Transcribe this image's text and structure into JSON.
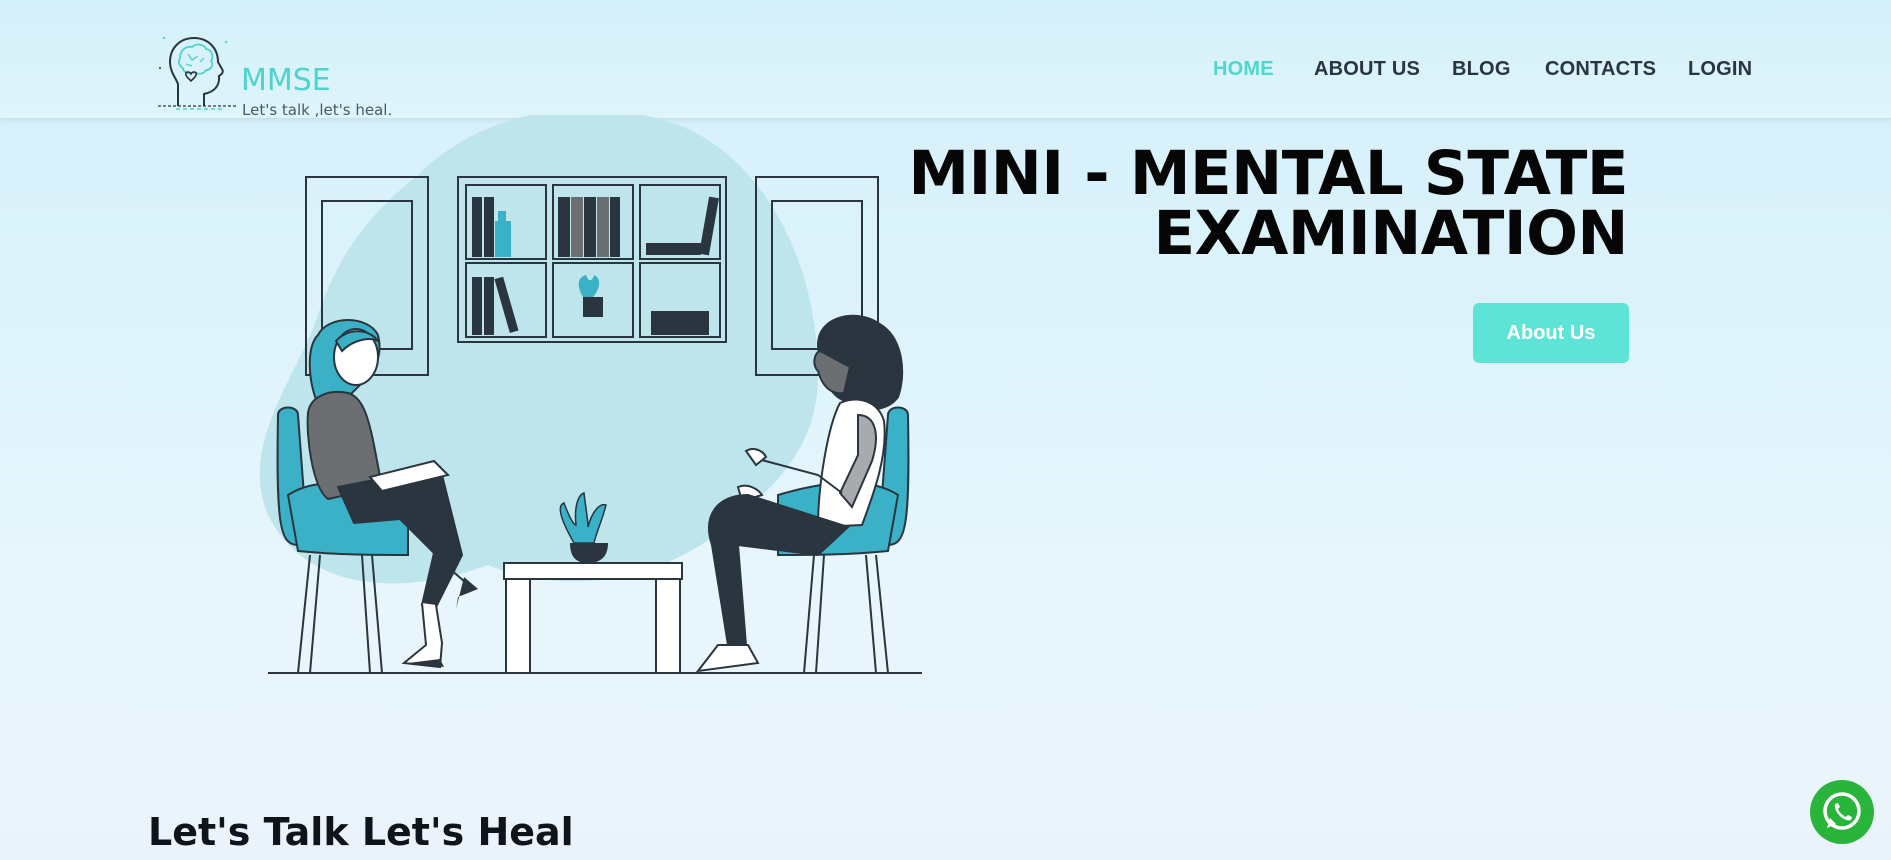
{
  "header": {
    "logo": {
      "title": "MMSE",
      "tagline": "Let's talk ,let's heal.",
      "icon": "brain-head-icon"
    },
    "nav": [
      {
        "label": "HOME",
        "active": true
      },
      {
        "label": "ABOUT US",
        "active": false
      },
      {
        "label": "BLOG",
        "active": false
      },
      {
        "label": "CONTACTS",
        "active": false
      },
      {
        "label": "LOGIN",
        "active": false
      }
    ]
  },
  "hero": {
    "title_line1": "MINI - MENTAL STATE",
    "title_line2": "EXAMINATION",
    "button_label": "About Us",
    "illustration": "therapy-session-illustration"
  },
  "section": {
    "heading": "Let's Talk Let's Heal"
  },
  "floating": {
    "whatsapp_icon": "whatsapp-icon"
  },
  "colors": {
    "accent": "#4fd6cf",
    "button": "#5de4d6",
    "teal_illustration": "#3ab1c6",
    "dark_text": "#060606",
    "whatsapp": "#29b43b"
  }
}
